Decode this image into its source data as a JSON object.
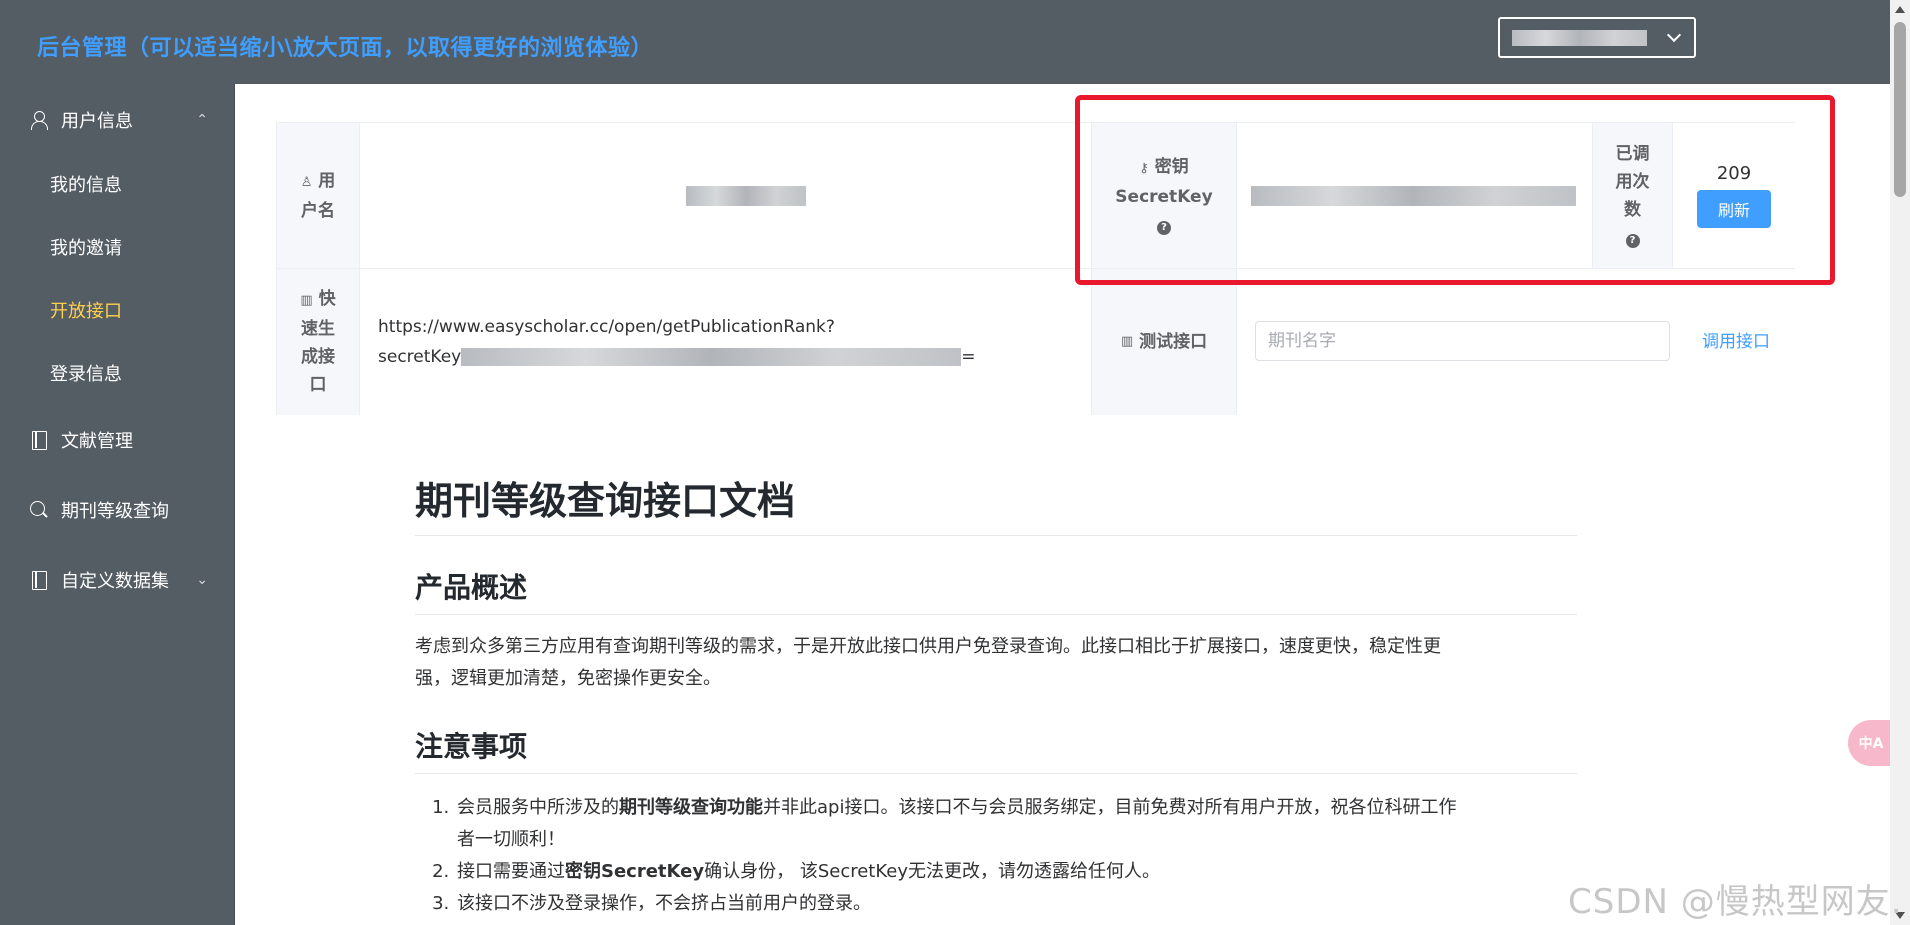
{
  "header": {
    "title": "后台管理（可以适当缩小\\放大页面，以取得更好的浏览体验）",
    "user_menu_icon": "chevron-down-icon"
  },
  "sidebar": {
    "user_info": {
      "label": "用户信息",
      "icon": "user-icon",
      "expanded": true,
      "arrow": "⌃"
    },
    "sub_items": [
      {
        "label": "我的信息"
      },
      {
        "label": "我的邀请"
      },
      {
        "label": "开放接口",
        "active": true
      },
      {
        "label": "登录信息"
      }
    ],
    "literature": {
      "label": "文献管理",
      "icon": "document-icon"
    },
    "journal_query": {
      "label": "期刊等级查询",
      "icon": "search-icon"
    },
    "custom_dataset": {
      "label": "自定义数据集",
      "icon": "document-icon",
      "arrow": "⌄"
    }
  },
  "info": {
    "username_label_1": "用",
    "username_label_2": "户名",
    "secret_label_1": "密钥",
    "secret_label_2": "SecretKey",
    "count_label_1": "已调",
    "count_label_2": "用次",
    "count_label_3": "数",
    "count_value": "209",
    "refresh_label": "刷新",
    "quick_label_1": "快",
    "quick_label_2": "速生",
    "quick_label_3": "成接",
    "quick_label_4": "口",
    "quick_url_1": "https://www.easyscholar.cc/open/getPublicationRank?",
    "quick_url_2": "secretKey",
    "quick_url_3": "=",
    "test_label": "测试接口",
    "test_placeholder": "期刊名字",
    "call_label": "调用接口",
    "help_symbol": "?"
  },
  "doc": {
    "title": "期刊等级查询接口文档",
    "overview_heading": "产品概述",
    "overview_text_1": "考虑到众多第三方应用有查询期刊等级的需求，于是开放此接口供用户免登录查询。此接口相比于扩展接口，速度更快，稳定性更",
    "overview_text_2": "强，逻辑更加清楚，免密操作更安全。",
    "notes_heading": "注意事项",
    "note1_pre": "会员服务中所涉及的",
    "note1_bold": "期刊等级查询功能",
    "note1_post_1": "并非此api接口。该接口不与会员服务绑定，目前免费对所有用户开放，祝各位科研工作",
    "note1_post_2": "者一切顺利！",
    "note2_pre": "接口需要通过",
    "note2_bold": "密钥SecretKey",
    "note2_post": "确认身份，  该SecretKey无法更改，请勿透露给任何人。",
    "note3": "该接口不涉及登录操作，不会挤占当前用户的登录。"
  },
  "floating": {
    "translate_label": "中A"
  },
  "watermark": "CSDN @慢热型网友."
}
